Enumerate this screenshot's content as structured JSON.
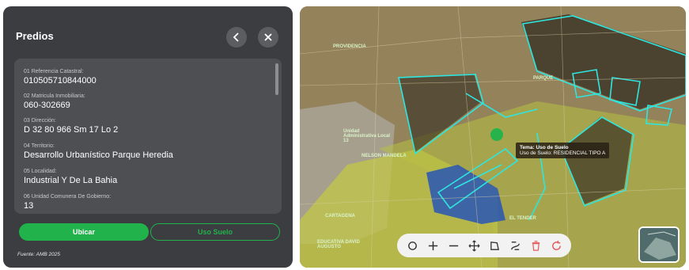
{
  "panel": {
    "title": "Predios",
    "fields": [
      {
        "label": "01 Referencia Catastral:",
        "value": "010505710844000"
      },
      {
        "label": "02 Matricula Inmobiliaria:",
        "value": "060-302669"
      },
      {
        "label": "03 Dirección:",
        "value": "D 32 80 966 Sm 17 Lo 2"
      },
      {
        "label": "04 Territorio:",
        "value": "Desarrollo Urbanístico Parque Heredia"
      },
      {
        "label": "05 Localidad:",
        "value": "Industrial Y De La Bahia"
      },
      {
        "label": "06 Unidad Comunera De Gobierno:",
        "value": "13"
      }
    ],
    "buttons": {
      "ubicar": "Ubicar",
      "uso_suelo": "Uso Suelo"
    },
    "footer": "Fuente: AMB 2025"
  },
  "map": {
    "labels": [
      "PROVIDENCIA",
      "PARQUE",
      "Unidad Administrativa Local 13",
      "NELSON MANDELA",
      "CARTAGENA",
      "EL TENDER",
      "EDUCATIVA DAVID AUGUSTO"
    ],
    "tooltip": {
      "title": "Tema: Uso de Suelo",
      "value": "Uso de Suelo: RESIDENCIAL TIPO A"
    },
    "toolbar_icons": [
      "circle-tool-icon",
      "zoom-in-icon",
      "zoom-out-icon",
      "pan-move-icon",
      "polygon-tool-icon",
      "route-tool-icon",
      "delete-icon",
      "refresh-icon"
    ],
    "colors": {
      "highlight": "#2ee6e0",
      "residential": "#c9d24a",
      "blue_zone": "#2856b5",
      "accent": "#22b24c",
      "delete": "#e45a5a"
    }
  }
}
